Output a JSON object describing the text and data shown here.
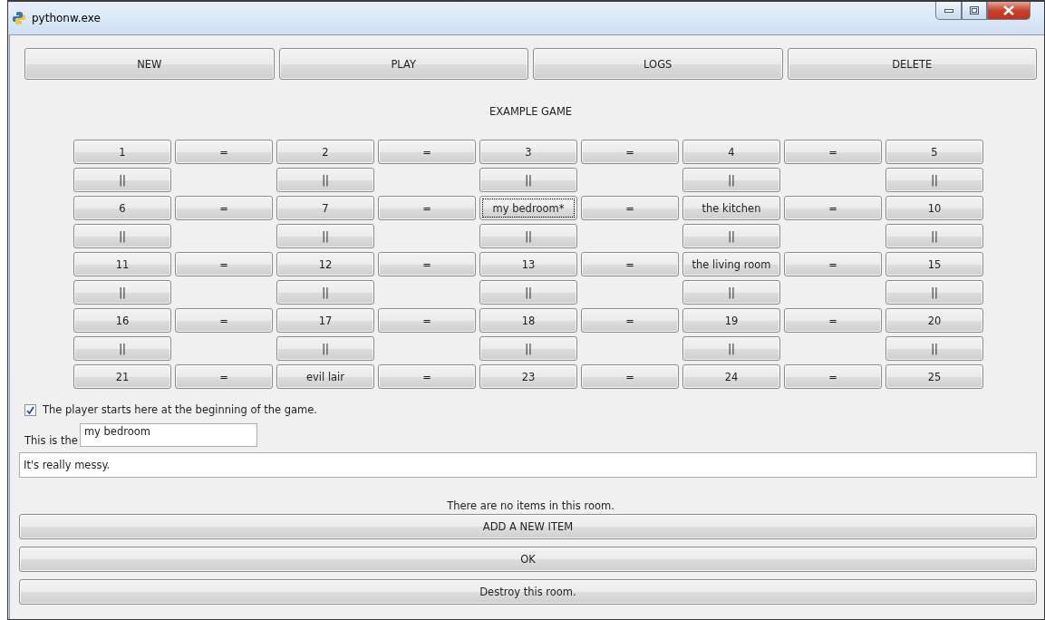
{
  "window": {
    "title": "pythonw.exe"
  },
  "toolbar": [
    {
      "label": "NEW"
    },
    {
      "label": "PLAY"
    },
    {
      "label": "LOGS"
    },
    {
      "label": "DELETE"
    }
  ],
  "game_title": "EXAMPLE GAME",
  "map_rows": [
    {
      "cells": [
        {
          "kind": "button",
          "label": "1",
          "selected": false
        },
        {
          "kind": "button",
          "label": "=",
          "selected": false
        },
        {
          "kind": "button",
          "label": "2",
          "selected": false
        },
        {
          "kind": "button",
          "label": "=",
          "selected": false
        },
        {
          "kind": "button",
          "label": "3",
          "selected": false
        },
        {
          "kind": "button",
          "label": "=",
          "selected": false
        },
        {
          "kind": "button",
          "label": "4",
          "selected": false
        },
        {
          "kind": "button",
          "label": "=",
          "selected": false
        },
        {
          "kind": "button",
          "label": "5",
          "selected": false
        }
      ]
    },
    {
      "cells": [
        {
          "kind": "button",
          "label": "||",
          "selected": false
        },
        {
          "kind": "empty"
        },
        {
          "kind": "button",
          "label": "||",
          "selected": false
        },
        {
          "kind": "empty"
        },
        {
          "kind": "button",
          "label": "||",
          "selected": false
        },
        {
          "kind": "empty"
        },
        {
          "kind": "button",
          "label": "||",
          "selected": false
        },
        {
          "kind": "empty"
        },
        {
          "kind": "button",
          "label": "||",
          "selected": false
        }
      ]
    },
    {
      "cells": [
        {
          "kind": "button",
          "label": "6",
          "selected": false
        },
        {
          "kind": "button",
          "label": "=",
          "selected": false
        },
        {
          "kind": "button",
          "label": "7",
          "selected": false
        },
        {
          "kind": "button",
          "label": "=",
          "selected": false
        },
        {
          "kind": "button",
          "label": "my bedroom*",
          "selected": true
        },
        {
          "kind": "button",
          "label": "=",
          "selected": false
        },
        {
          "kind": "button",
          "label": "the kitchen",
          "selected": false
        },
        {
          "kind": "button",
          "label": "=",
          "selected": false
        },
        {
          "kind": "button",
          "label": "10",
          "selected": false
        }
      ]
    },
    {
      "cells": [
        {
          "kind": "button",
          "label": "||",
          "selected": false
        },
        {
          "kind": "empty"
        },
        {
          "kind": "button",
          "label": "||",
          "selected": false
        },
        {
          "kind": "empty"
        },
        {
          "kind": "button",
          "label": "||",
          "selected": false
        },
        {
          "kind": "empty"
        },
        {
          "kind": "button",
          "label": "||",
          "selected": false
        },
        {
          "kind": "empty"
        },
        {
          "kind": "button",
          "label": "||",
          "selected": false
        }
      ]
    },
    {
      "cells": [
        {
          "kind": "button",
          "label": "11",
          "selected": false
        },
        {
          "kind": "button",
          "label": "=",
          "selected": false
        },
        {
          "kind": "button",
          "label": "12",
          "selected": false
        },
        {
          "kind": "button",
          "label": "=",
          "selected": false
        },
        {
          "kind": "button",
          "label": "13",
          "selected": false
        },
        {
          "kind": "button",
          "label": "=",
          "selected": false
        },
        {
          "kind": "button",
          "label": "the living room",
          "selected": false
        },
        {
          "kind": "button",
          "label": "=",
          "selected": false
        },
        {
          "kind": "button",
          "label": "15",
          "selected": false
        }
      ]
    },
    {
      "cells": [
        {
          "kind": "button",
          "label": "||",
          "selected": false
        },
        {
          "kind": "empty"
        },
        {
          "kind": "button",
          "label": "||",
          "selected": false
        },
        {
          "kind": "empty"
        },
        {
          "kind": "button",
          "label": "||",
          "selected": false
        },
        {
          "kind": "empty"
        },
        {
          "kind": "button",
          "label": "||",
          "selected": false
        },
        {
          "kind": "empty"
        },
        {
          "kind": "button",
          "label": "||",
          "selected": false
        }
      ]
    },
    {
      "cells": [
        {
          "kind": "button",
          "label": "16",
          "selected": false
        },
        {
          "kind": "button",
          "label": "=",
          "selected": false
        },
        {
          "kind": "button",
          "label": "17",
          "selected": false
        },
        {
          "kind": "button",
          "label": "=",
          "selected": false
        },
        {
          "kind": "button",
          "label": "18",
          "selected": false
        },
        {
          "kind": "button",
          "label": "=",
          "selected": false
        },
        {
          "kind": "button",
          "label": "19",
          "selected": false
        },
        {
          "kind": "button",
          "label": "=",
          "selected": false
        },
        {
          "kind": "button",
          "label": "20",
          "selected": false
        }
      ]
    },
    {
      "cells": [
        {
          "kind": "button",
          "label": "||",
          "selected": false
        },
        {
          "kind": "empty"
        },
        {
          "kind": "button",
          "label": "||",
          "selected": false
        },
        {
          "kind": "empty"
        },
        {
          "kind": "button",
          "label": "||",
          "selected": false
        },
        {
          "kind": "empty"
        },
        {
          "kind": "button",
          "label": "||",
          "selected": false
        },
        {
          "kind": "empty"
        },
        {
          "kind": "button",
          "label": "||",
          "selected": false
        }
      ]
    },
    {
      "cells": [
        {
          "kind": "button",
          "label": "21",
          "selected": false
        },
        {
          "kind": "button",
          "label": "=",
          "selected": false
        },
        {
          "kind": "button",
          "label": "evil lair",
          "selected": false
        },
        {
          "kind": "button",
          "label": "=",
          "selected": false
        },
        {
          "kind": "button",
          "label": "23",
          "selected": false
        },
        {
          "kind": "button",
          "label": "=",
          "selected": false
        },
        {
          "kind": "button",
          "label": "24",
          "selected": false
        },
        {
          "kind": "button",
          "label": "=",
          "selected": false
        },
        {
          "kind": "button",
          "label": "25",
          "selected": false
        }
      ]
    }
  ],
  "start_checkbox": {
    "label": "The player starts here at the beginning of the game.",
    "checked": true
  },
  "room_name": {
    "label": "This is the",
    "value": "my bedroom"
  },
  "description": {
    "value": "It's really messy."
  },
  "items_message": "There are no items in this room.",
  "actions": [
    {
      "label": "ADD A NEW ITEM"
    },
    {
      "label": "OK"
    },
    {
      "label": "Destroy this room."
    }
  ]
}
